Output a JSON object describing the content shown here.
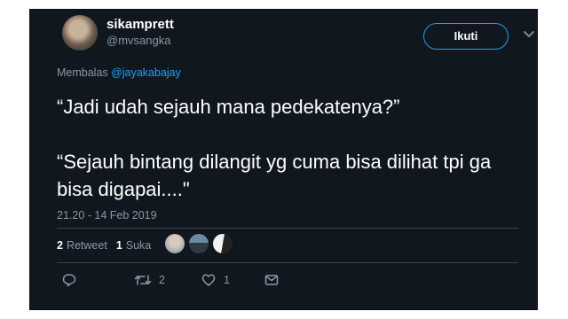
{
  "user": {
    "display_name": "sikamprett",
    "handle": "@mvsangka"
  },
  "follow_button": {
    "label": "Ikuti"
  },
  "reply": {
    "prefix": "Membalas",
    "mention": "@jayakabajay"
  },
  "tweet": {
    "text": "“Jadi udah sejauh mana pedekatenya?”\n\n“Sejauh bintang dilangit yg cuma bisa dilihat tpi ga bisa digapai....\""
  },
  "timestamp": "21.20 - 14 Feb 2019",
  "stats": {
    "retweet_count": "2",
    "retweet_label": "Retweet",
    "like_count": "1",
    "like_label": "Suka"
  },
  "actions": {
    "reply_count": "",
    "retweet_count": "2",
    "like_count": "1"
  },
  "icons": [
    "reply-icon",
    "retweet-icon",
    "like-icon",
    "message-icon",
    "chevron-down-icon"
  ],
  "colors": {
    "background": "#10171e",
    "accent": "#1da1f2",
    "muted": "#8899a6",
    "text": "#ffffff",
    "divider": "#38444d"
  }
}
